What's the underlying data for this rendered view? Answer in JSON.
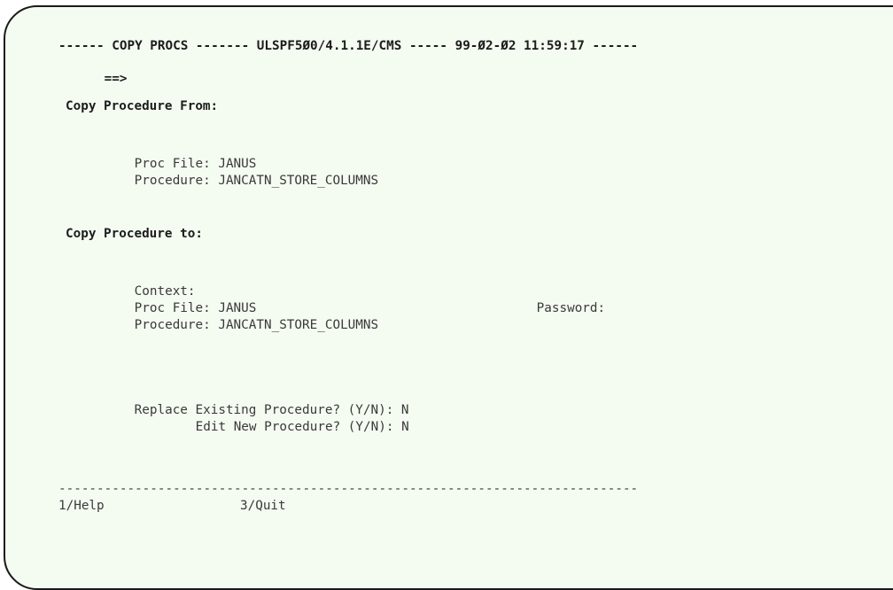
{
  "header": {
    "line": "------ COPY PROCS ------- ULSPF5Ø0/4.1.1E/CMS ----- 99-Ø2-Ø2 11:59:17 ------",
    "command_prompt": "==>",
    "command_value": ""
  },
  "from_section": {
    "title": "Copy Procedure From:",
    "proc_file_label": "Proc File:",
    "proc_file_value": "JANUS",
    "procedure_label": "Procedure:",
    "procedure_value": "JANCATN_STORE_COLUMNS"
  },
  "to_section": {
    "title": "Copy Procedure to:",
    "context_label": "Context:",
    "context_value": "",
    "proc_file_label": "Proc File:",
    "proc_file_value": "JANUS",
    "password_label": "Password:",
    "password_value": "",
    "procedure_label": "Procedure:",
    "procedure_value": "JANCATN_STORE_COLUMNS"
  },
  "options": {
    "replace_label": "Replace Existing Procedure? (Y/N):",
    "replace_value": "N",
    "edit_label": "Edit New Procedure? (Y/N):",
    "edit_value": "N"
  },
  "footer": {
    "divider": "----------------------------------------------------------------------------",
    "pf1": "1/Help",
    "pf3": "3/Quit"
  }
}
